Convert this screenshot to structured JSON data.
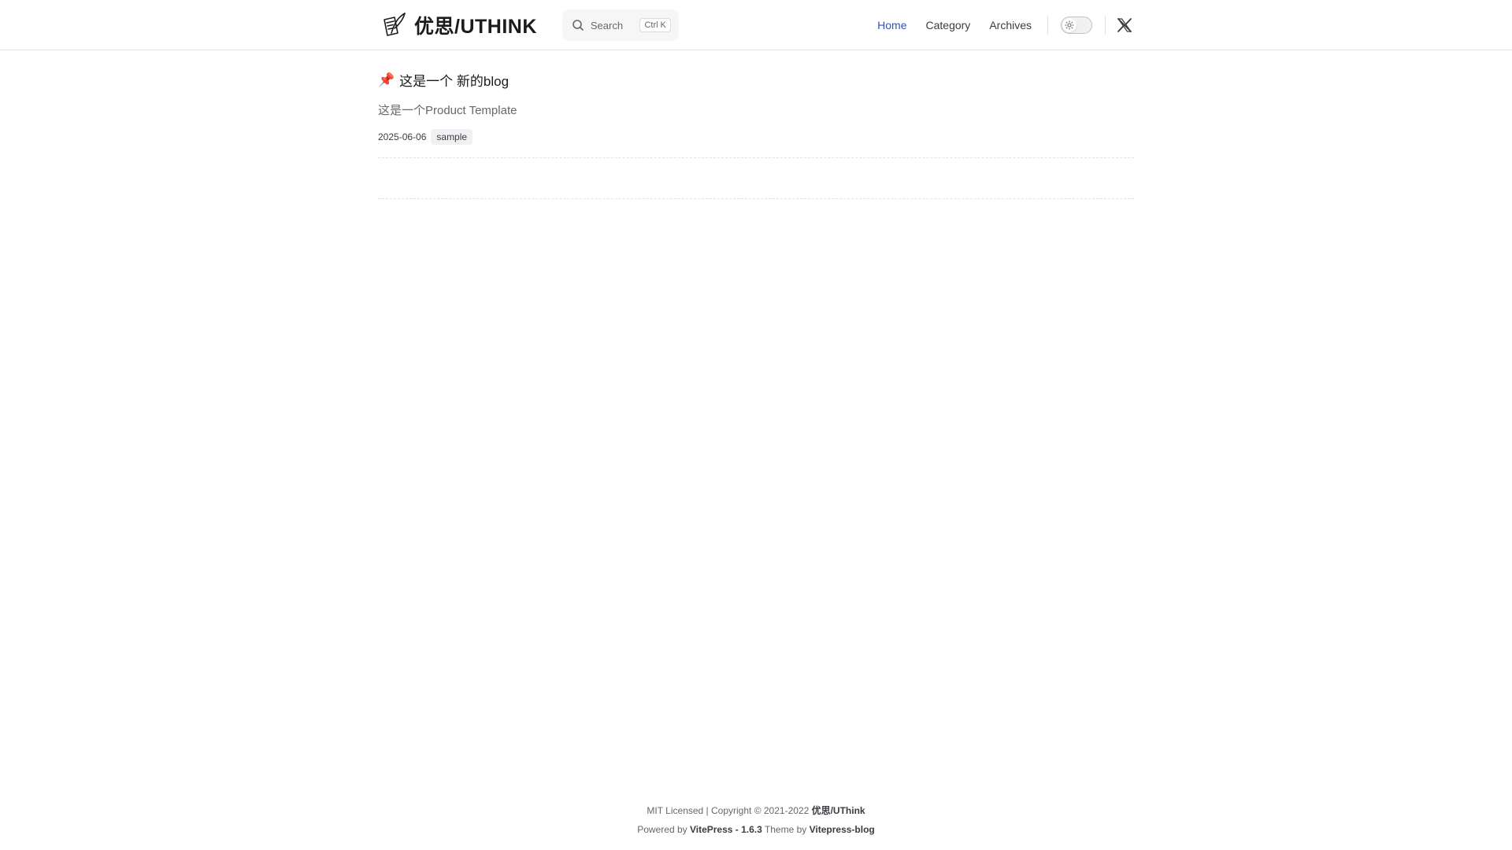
{
  "header": {
    "title": "优思/UTHINK",
    "logo_icon": "quill-paper-icon",
    "search": {
      "label": "Search",
      "key1": "Ctrl",
      "key2": "K"
    },
    "nav": [
      {
        "label": "Home",
        "active": true
      },
      {
        "label": "Category",
        "active": false
      },
      {
        "label": "Archives",
        "active": false
      }
    ],
    "theme_toggle_icon": "sun-icon",
    "social_icon": "x-twitter-icon"
  },
  "posts": [
    {
      "pin": "📌",
      "title": "这是一个 新的blog",
      "description": "这是一个Product Template",
      "date": "2025-06-06",
      "tag": "sample"
    }
  ],
  "footer": {
    "line1_prefix": "MIT Licensed | Copyright © 2021-2022 ",
    "line1_strong": "优思/UThink",
    "line2_prefix": "Powered by ",
    "line2_strong1": "VitePress - 1.6.3",
    "line2_mid": " Theme by ",
    "line2_strong2": "Vitepress-blog"
  },
  "colors": {
    "accent": "#3451b2",
    "text": "#3c3c43",
    "muted": "#67676c",
    "border": "#e2e2e3"
  }
}
